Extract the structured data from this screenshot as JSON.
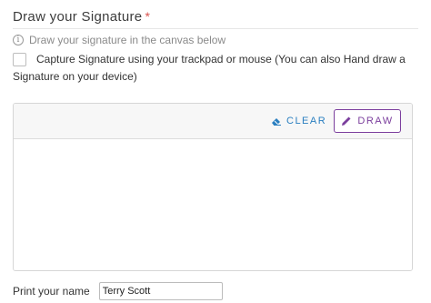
{
  "section": {
    "title": "Draw your Signature",
    "required_mark": "*",
    "info_text": "Draw your signature in the canvas below",
    "capture_label": "Capture Signature using your trackpad or mouse (You can also Hand draw a Signature on your device)",
    "capture_checked": false
  },
  "toolbar": {
    "clear_label": "CLEAR",
    "draw_label": "DRAW"
  },
  "name": {
    "label": "Print your name",
    "value": "Terry Scott"
  },
  "colors": {
    "accent_purple": "#7b3e9d",
    "link_blue": "#2a7fc0",
    "required_red": "#d9534f"
  }
}
